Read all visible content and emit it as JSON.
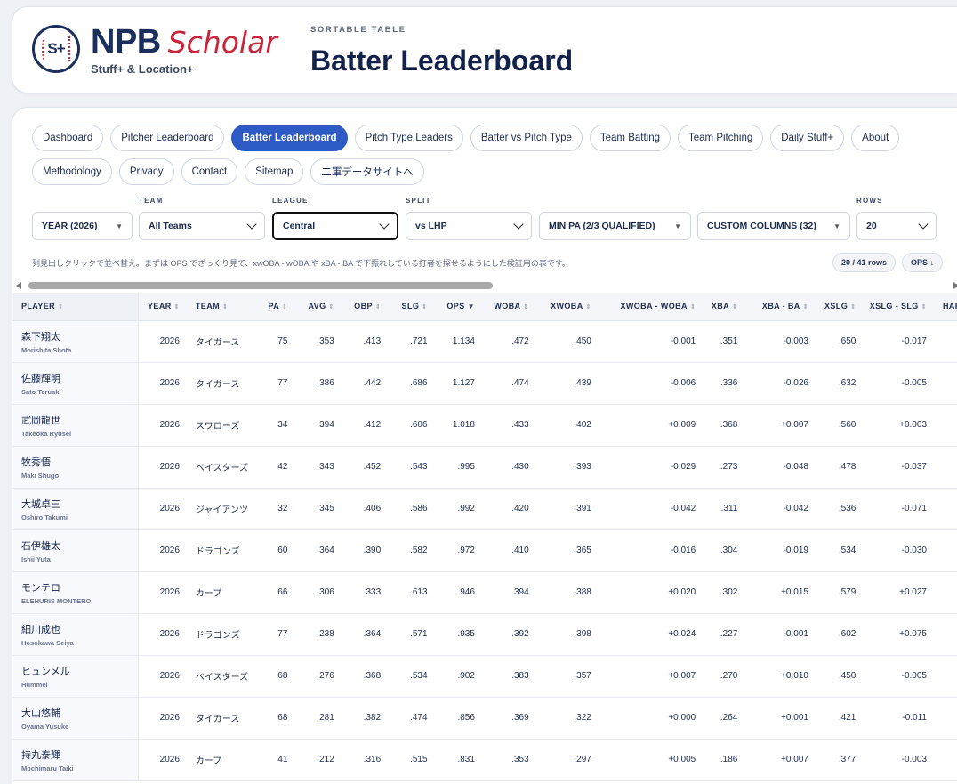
{
  "brand": {
    "npb": "NPB",
    "scholar": "Scholar",
    "subtitle": "Stuff+ & Location+",
    "logo_text": "S+"
  },
  "header": {
    "kicker": "SORTABLE TABLE",
    "title": "Batter Leaderboard"
  },
  "nav": {
    "row1": [
      "Dashboard",
      "Pitcher Leaderboard",
      "Batter Leaderboard",
      "Pitch Type Leaders",
      "Batter vs Pitch Type",
      "Team Batting",
      "Team Pitching",
      "Daily Stuff+",
      "About"
    ],
    "row2": [
      "Methodology",
      "Privacy",
      "Contact",
      "Sitemap",
      "二軍データサイトへ"
    ],
    "active": "Batter Leaderboard"
  },
  "filters": {
    "year": {
      "label": "",
      "value": "YEAR (2026)"
    },
    "team": {
      "label": "TEAM",
      "value": "All Teams"
    },
    "league": {
      "label": "LEAGUE",
      "value": "Central"
    },
    "split": {
      "label": "SPLIT",
      "value": "vs LHP"
    },
    "min_pa": {
      "label": "",
      "value": "MIN PA (2/3 QUALIFIED)"
    },
    "columns": {
      "label": "",
      "value": "CUSTOM COLUMNS (32)"
    },
    "rows": {
      "label": "ROWS",
      "value": "20"
    }
  },
  "hint": "列見出しクリックで並べ替え。まずは OPS でざっくり見て、xwOBA - wOBA や xBA - BA で下振れしている打者を探せるようにした検証用の表です。",
  "row_count": "20 / 41 rows",
  "sort_chip": "OPS ↓",
  "table": {
    "columns": [
      "PLAYER",
      "YEAR",
      "TEAM",
      "PA",
      "AVG",
      "OBP",
      "SLG",
      "OPS",
      "WOBA",
      "XWOBA",
      "XWOBA - WOBA",
      "XBA",
      "XBA - BA",
      "XSLG",
      "XSLG - SLG",
      "HARDHIT"
    ],
    "sorted_column": "OPS",
    "rows": [
      {
        "name": "森下翔太",
        "roman": "Morishita Shota",
        "year": "2026",
        "team": "タイガース",
        "pa": "75",
        "avg": ".353",
        "obp": ".413",
        "slg": ".721",
        "ops": "1.134",
        "woba": ".472",
        "xwoba": ".450",
        "xwoba_woba": "-0.001",
        "xba": ".351",
        "xba_ba": "-0.003",
        "xslg": ".650",
        "xslg_slg": "-0.017"
      },
      {
        "name": "佐藤輝明",
        "roman": "Sato Teruaki",
        "year": "2026",
        "team": "タイガース",
        "pa": "77",
        "avg": ".386",
        "obp": ".442",
        "slg": ".686",
        "ops": "1.127",
        "woba": ".474",
        "xwoba": ".439",
        "xwoba_woba": "-0.006",
        "xba": ".336",
        "xba_ba": "-0.026",
        "xslg": ".632",
        "xslg_slg": "-0.005"
      },
      {
        "name": "武岡龍世",
        "roman": "Takeoka Ryusei",
        "year": "2026",
        "team": "スワローズ",
        "pa": "34",
        "avg": ".394",
        "obp": ".412",
        "slg": ".606",
        "ops": "1.018",
        "woba": ".433",
        "xwoba": ".402",
        "xwoba_woba": "+0.009",
        "xba": ".368",
        "xba_ba": "+0.007",
        "xslg": ".560",
        "xslg_slg": "+0.003"
      },
      {
        "name": "牧秀悟",
        "roman": "Maki Shugo",
        "year": "2026",
        "team": "ベイスターズ",
        "pa": "42",
        "avg": ".343",
        "obp": ".452",
        "slg": ".543",
        "ops": ".995",
        "woba": ".430",
        "xwoba": ".393",
        "xwoba_woba": "-0.029",
        "xba": ".273",
        "xba_ba": "-0.048",
        "xslg": ".478",
        "xslg_slg": "-0.037"
      },
      {
        "name": "大城卓三",
        "roman": "Oshiro Takumi",
        "year": "2026",
        "team": "ジャイアンツ",
        "pa": "32",
        "avg": ".345",
        "obp": ".406",
        "slg": ".586",
        "ops": ".992",
        "woba": ".420",
        "xwoba": ".391",
        "xwoba_woba": "-0.042",
        "xba": ".311",
        "xba_ba": "-0.042",
        "xslg": ".536",
        "xslg_slg": "-0.071"
      },
      {
        "name": "石伊雄太",
        "roman": "Ishii Yuta",
        "year": "2026",
        "team": "ドラゴンズ",
        "pa": "60",
        "avg": ".364",
        "obp": ".390",
        "slg": ".582",
        "ops": ".972",
        "woba": ".410",
        "xwoba": ".365",
        "xwoba_woba": "-0.016",
        "xba": ".304",
        "xba_ba": "-0.019",
        "xslg": ".534",
        "xslg_slg": "-0.030"
      },
      {
        "name": "モンテロ",
        "roman": "ELEHURIS MONTERO",
        "year": "2026",
        "team": "カープ",
        "pa": "66",
        "avg": ".306",
        "obp": ".333",
        "slg": ".613",
        "ops": ".946",
        "woba": ".394",
        "xwoba": ".388",
        "xwoba_woba": "+0.020",
        "xba": ".302",
        "xba_ba": "+0.015",
        "xslg": ".579",
        "xslg_slg": "+0.027"
      },
      {
        "name": "細川成也",
        "roman": "Hosokawa Seiya",
        "year": "2026",
        "team": "ドラゴンズ",
        "pa": "77",
        "avg": ".238",
        "obp": ".364",
        "slg": ".571",
        "ops": ".935",
        "woba": ".392",
        "xwoba": ".398",
        "xwoba_woba": "+0.024",
        "xba": ".227",
        "xba_ba": "-0.001",
        "xslg": ".602",
        "xslg_slg": "+0.075"
      },
      {
        "name": "ヒュンメル",
        "roman": "Hummel",
        "year": "2026",
        "team": "ベイスターズ",
        "pa": "68",
        "avg": ".276",
        "obp": ".368",
        "slg": ".534",
        "ops": ".902",
        "woba": ".383",
        "xwoba": ".357",
        "xwoba_woba": "+0.007",
        "xba": ".270",
        "xba_ba": "+0.010",
        "xslg": ".450",
        "xslg_slg": "-0.005"
      },
      {
        "name": "大山悠輔",
        "roman": "Oyama Yusuke",
        "year": "2026",
        "team": "タイガース",
        "pa": "68",
        "avg": ".281",
        "obp": ".382",
        "slg": ".474",
        "ops": ".856",
        "woba": ".369",
        "xwoba": ".322",
        "xwoba_woba": "+0.000",
        "xba": ".264",
        "xba_ba": "+0.001",
        "xslg": ".421",
        "xslg_slg": "-0.011"
      },
      {
        "name": "持丸泰輝",
        "roman": "Mochimaru Taiki",
        "year": "2026",
        "team": "カープ",
        "pa": "41",
        "avg": ".212",
        "obp": ".316",
        "slg": ".515",
        "ops": ".831",
        "woba": ".353",
        "xwoba": ".297",
        "xwoba_woba": "+0.005",
        "xba": ".186",
        "xba_ba": "+0.007",
        "xslg": ".377",
        "xslg_slg": "-0.003"
      }
    ]
  },
  "colors": {
    "accent": "#2d5ac4",
    "navy": "#13224a",
    "brand_red": "#c8243b"
  }
}
